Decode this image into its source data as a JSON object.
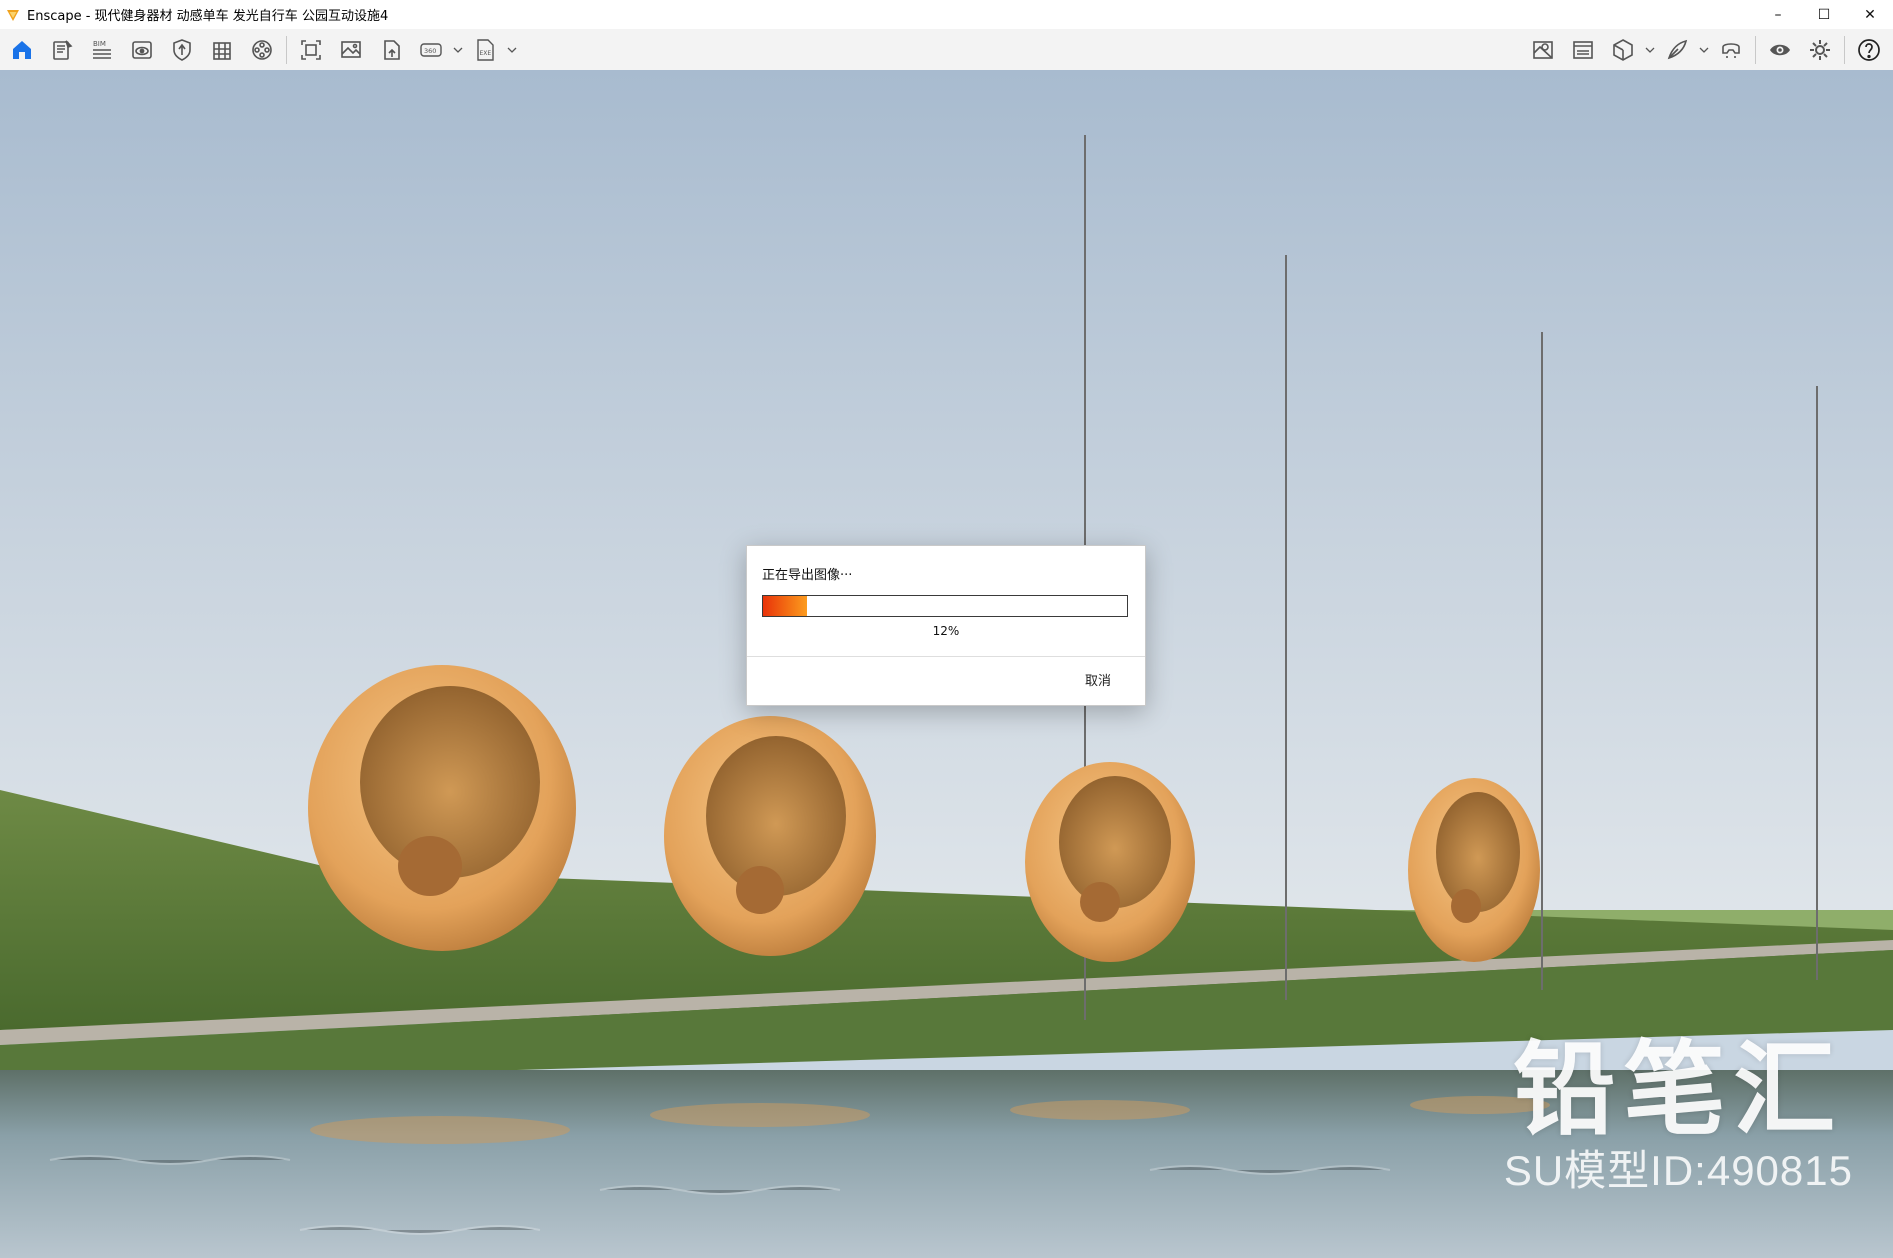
{
  "app": {
    "title": "Enscape - 现代健身器材 动感单车 发光自行车 公园互动设施4",
    "logo_icon": "enscape-logo-icon",
    "accent_color": "#1a73e8"
  },
  "window_controls": {
    "minimize": "–",
    "maximize": "☐",
    "close": "✕"
  },
  "toolbar": {
    "left_tools": [
      {
        "id": "home",
        "icon": "home-icon"
      },
      {
        "id": "notes",
        "icon": "document-icon"
      },
      {
        "id": "bim",
        "icon": "bim-icon",
        "badge": "BIM"
      },
      {
        "id": "views",
        "icon": "eye-view-icon"
      },
      {
        "id": "asset-library",
        "icon": "shield-asset-icon"
      },
      {
        "id": "materials",
        "icon": "building-icon"
      },
      {
        "id": "video",
        "icon": "film-reel-icon"
      },
      {
        "id": "screenshot",
        "icon": "screenshot-icon"
      },
      {
        "id": "batch-render",
        "icon": "image-gallery-icon"
      },
      {
        "id": "upload",
        "icon": "upload-file-icon"
      },
      {
        "id": "panorama",
        "icon": "panorama-360-icon",
        "badge": "360",
        "has_caret": true
      },
      {
        "id": "export-exe",
        "icon": "export-exe-icon",
        "badge": "EXE",
        "has_caret": true
      }
    ],
    "right_tools": [
      {
        "id": "visual-settings-map",
        "icon": "map-pin-icon"
      },
      {
        "id": "atmosphere",
        "icon": "image-frame-icon"
      },
      {
        "id": "cube-view",
        "icon": "cube-icon",
        "has_caret": true
      },
      {
        "id": "sketch",
        "icon": "feather-icon",
        "has_caret": true
      },
      {
        "id": "vr-headset",
        "icon": "vr-headset-icon"
      },
      {
        "id": "view-toggle",
        "icon": "eye-icon"
      },
      {
        "id": "settings",
        "icon": "gear-icon"
      },
      {
        "id": "help",
        "icon": "help-icon"
      }
    ],
    "collapse_icon": "chevron-up-icon"
  },
  "dialog": {
    "title": "正在导出图像···",
    "progress_percent": 12,
    "progress_label": "12%",
    "cancel_label": "取消"
  },
  "watermark": {
    "brand": "铅笔汇",
    "model_id": "SU模型ID:490815"
  }
}
